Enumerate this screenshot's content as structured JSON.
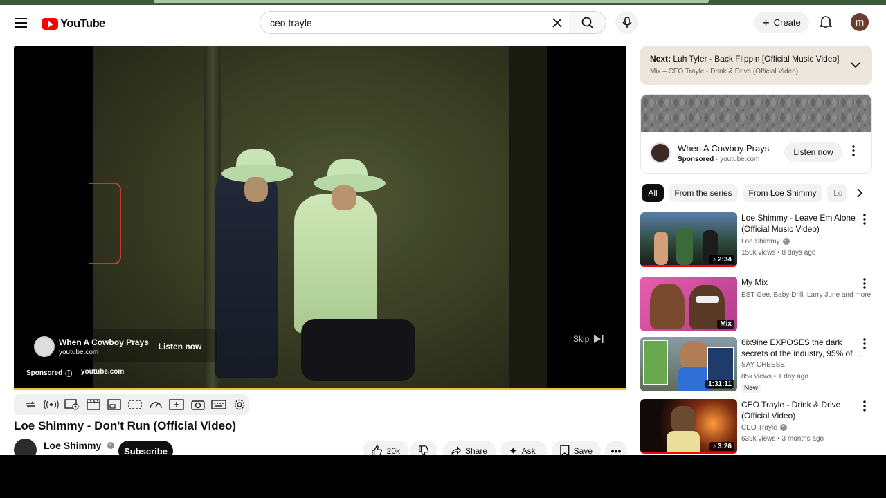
{
  "app": {
    "logo_text": "YouTube"
  },
  "search": {
    "query": "ceo trayle"
  },
  "header": {
    "create_label": "Create",
    "avatar_letter": "m"
  },
  "player": {
    "ad": {
      "title": "When A Cowboy Prays",
      "domain": "youtube.com",
      "cta": "Listen now",
      "sponsored": "Sponsored",
      "sponsored_domain": "youtube.com"
    },
    "skip_label": "Skip"
  },
  "video": {
    "title": "Loe Shimmy - Don't Run (Official Video)",
    "channel": "Loe Shimmy",
    "subscribe": "Subscribe",
    "likes": "20k",
    "share": "Share",
    "ask": "Ask",
    "save": "Save"
  },
  "next": {
    "prefix": "Next:",
    "title": "Luh Tyler - Back Flippin [Official Music Video]",
    "subtitle": "Mix – CEO Trayle - Drink & Drive (Official Video)"
  },
  "ad_card": {
    "title": "When A Cowboy Prays",
    "sponsored": "Sponsored",
    "domain": "youtube.com",
    "cta": "Listen now"
  },
  "chips": [
    "All",
    "From the series",
    "From Loe Shimmy",
    "Lo"
  ],
  "recommendations": [
    {
      "title": "Loe Shimmy - Leave Em Alone (Official Music Video)",
      "channel": "Loe Shimmy",
      "meta": "150k views • 8 days ago",
      "badge": "♪ 2:34",
      "verified": true
    },
    {
      "title": "My Mix",
      "channel": "EST Gee, Baby Drill, Larry June and more",
      "meta": "",
      "badge": "Mix",
      "verified": false
    },
    {
      "title": "6ix9ine EXPOSES the dark secrets of the industry, 95% of ...",
      "channel": "SAY CHEESE!",
      "meta": "85k views • 1 day ago",
      "badge": "1:31:11",
      "new": "New",
      "verified": false
    },
    {
      "title": "CEO Trayle - Drink & Drive (Official Video)",
      "channel": "CEO Trayle",
      "meta": "639k views • 3 months ago",
      "badge": "♪ 3:26",
      "verified": true
    }
  ],
  "colors": {
    "brand_red": "#ff0000",
    "progress": "#f3c32f"
  }
}
